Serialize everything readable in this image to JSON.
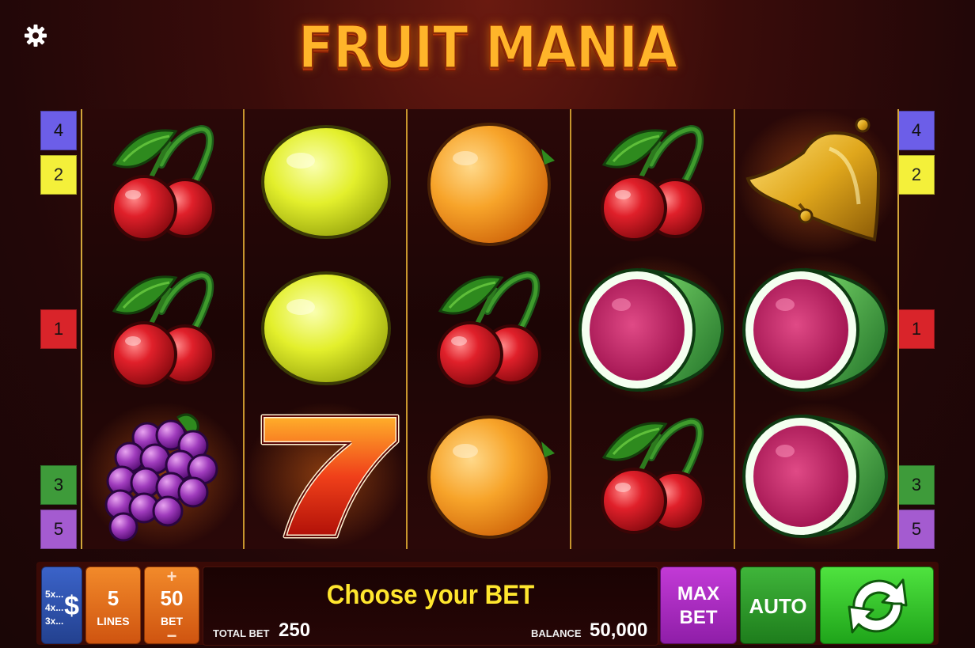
{
  "game": {
    "title": "FRUIT MANIA"
  },
  "settings": {
    "icon": "gear-icon"
  },
  "reels": [
    [
      "cherries",
      "cherries",
      "grapes"
    ],
    [
      "lemon",
      "lemon",
      "seven"
    ],
    [
      "orange",
      "cherries",
      "orange"
    ],
    [
      "cherries",
      "watermelon",
      "cherries"
    ],
    [
      "bell",
      "watermelon",
      "watermelon"
    ]
  ],
  "line_markers": {
    "left": [
      "4",
      "2",
      "1",
      "3",
      "5"
    ],
    "right": [
      "4",
      "2",
      "1",
      "3",
      "5"
    ]
  },
  "controls": {
    "paytable": {
      "rows": [
        "5x...",
        "4x...",
        "3x..."
      ],
      "symbol": "$"
    },
    "lines": {
      "value": "5",
      "label": "LINES"
    },
    "bet": {
      "plus": "+",
      "value": "50",
      "label": "BET",
      "minus": "−"
    },
    "message": "Choose your BET",
    "total_bet": {
      "label": "TOTAL BET",
      "value": "250"
    },
    "balance": {
      "label": "BALANCE",
      "value": "50,000"
    },
    "max_bet": {
      "line1": "MAX",
      "line2": "BET"
    },
    "auto": "AUTO",
    "spin_icon": "refresh-icon"
  },
  "colors": {
    "line_1": "#d9242a",
    "line_2": "#f4f03a",
    "line_3": "#3e9b3a",
    "line_4": "#6c5ee8",
    "line_5": "#a45bd0",
    "message": "#ffe62e",
    "spin": "#3fd530",
    "auto": "#2e9a2a",
    "max_bet": "#b02fc7",
    "bet": "#e0661a"
  }
}
